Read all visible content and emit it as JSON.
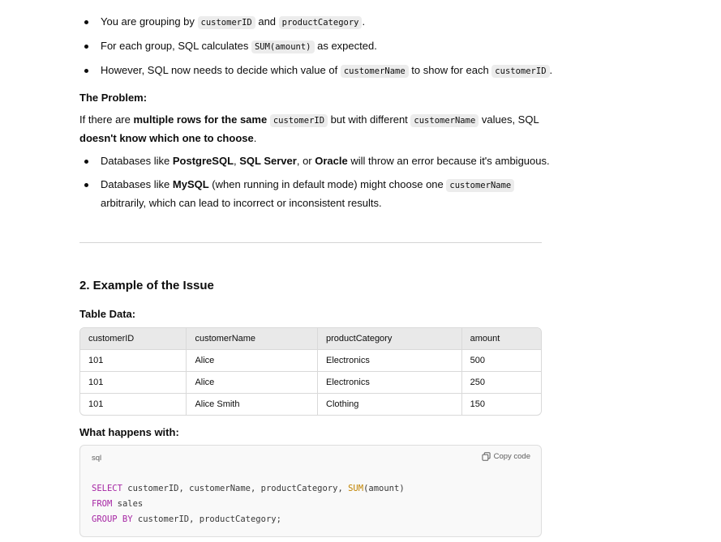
{
  "bullets_top": [
    {
      "before": "You are grouping by ",
      "code1": "customerID",
      "mid": " and ",
      "code2": "productCategory",
      "after": "."
    },
    {
      "before": "For each group, SQL calculates ",
      "code1": "SUM(amount)",
      "after": " as expected."
    },
    {
      "before": "However, SQL now needs to decide which value of ",
      "code1": "customerName",
      "mid": " to show for each ",
      "code2": "customerID",
      "after": "."
    }
  ],
  "problem": {
    "heading": "The Problem:",
    "p_start": "If there are ",
    "p_bold1": "multiple rows for the same",
    "p_code1": "customerID",
    "p_mid": " but with different ",
    "p_code2": "customerName",
    "p_mid2": " values, SQL ",
    "p_bold2": "doesn't know which one to choose",
    "p_end": "."
  },
  "bullets_db": [
    {
      "pre": "Databases like ",
      "b1": "PostgreSQL",
      "s1": ", ",
      "b2": "SQL Server",
      "s2": ", or ",
      "b3": "Oracle",
      "post": " will throw an error because it's ambiguous."
    },
    {
      "pre": "Databases like ",
      "b1": "MySQL",
      "mid": " (when running in default mode) might choose one ",
      "code": "customerName",
      "post": "arbitrarily, which can lead to incorrect or inconsistent results."
    }
  ],
  "section": {
    "title": "2. Example of the Issue",
    "table_label": "Table Data:"
  },
  "table": {
    "headers": [
      "customerID",
      "customerName",
      "productCategory",
      "amount"
    ],
    "rows": [
      [
        "101",
        "Alice",
        "Electronics",
        "500"
      ],
      [
        "101",
        "Alice",
        "Electronics",
        "250"
      ],
      [
        "101",
        "Alice Smith",
        "Clothing",
        "150"
      ]
    ]
  },
  "what_happens": "What happens with:",
  "code_block": {
    "language": "sql",
    "copy_label": "Copy code",
    "line1": {
      "kw": "SELECT",
      "a": " customerID, customerName, productCategory, ",
      "fn": "SUM",
      "b": "(amount)"
    },
    "line2": {
      "kw": "FROM",
      "a": " sales"
    },
    "line3": {
      "kw": "GROUP BY",
      "a": " customerID, productCategory;"
    }
  }
}
